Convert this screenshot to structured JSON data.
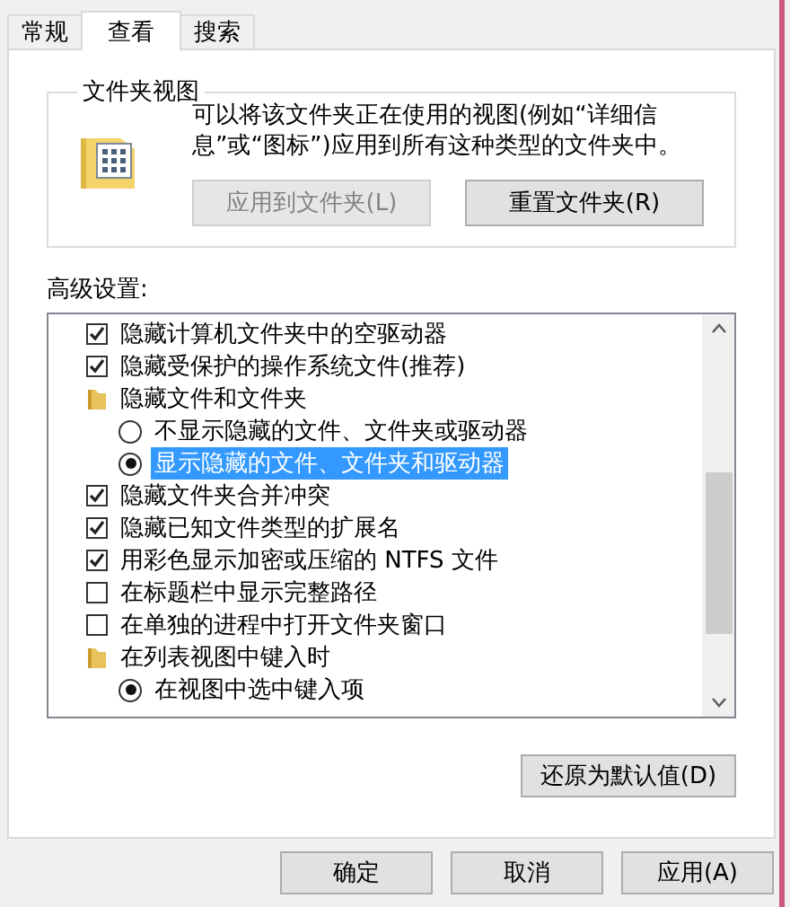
{
  "tabs": [
    {
      "label": "常规",
      "selected": false
    },
    {
      "label": "查看",
      "selected": true
    },
    {
      "label": "搜索",
      "selected": false
    }
  ],
  "folder_views": {
    "title": "文件夹视图",
    "description": "可以将该文件夹正在使用的视图(例如“详细信息”或“图标”)应用到所有这种类型的文件夹中。",
    "buttons": [
      {
        "label": "应用到文件夹(L)",
        "disabled": true
      },
      {
        "label": "重置文件夹(R)",
        "disabled": false
      }
    ]
  },
  "advanced": {
    "label": "高级设置:",
    "items": [
      {
        "kind": "checkbox",
        "label": "隐藏计算机文件夹中的空驱动器",
        "checked": true
      },
      {
        "kind": "checkbox",
        "label": "隐藏受保护的操作系统文件(推荐)",
        "checked": true
      },
      {
        "kind": "folder",
        "label": "隐藏文件和文件夹",
        "children": [
          {
            "kind": "radio",
            "label": "不显示隐藏的文件、文件夹或驱动器",
            "selected": false,
            "highlighted": false
          },
          {
            "kind": "radio",
            "label": "显示隐藏的文件、文件夹和驱动器",
            "selected": true,
            "highlighted": true
          }
        ]
      },
      {
        "kind": "checkbox",
        "label": "隐藏文件夹合并冲突",
        "checked": true
      },
      {
        "kind": "checkbox",
        "label": "隐藏已知文件类型的扩展名",
        "checked": true
      },
      {
        "kind": "checkbox",
        "label": "用彩色显示加密或压缩的 NTFS 文件",
        "checked": true
      },
      {
        "kind": "checkbox",
        "label": "在标题栏中显示完整路径",
        "checked": false
      },
      {
        "kind": "checkbox",
        "label": "在单独的进程中打开文件夹窗口",
        "checked": false
      },
      {
        "kind": "folder",
        "label": "在列表视图中键入时",
        "children": [
          {
            "kind": "radio",
            "label": "在视图中选中键入项",
            "selected": true,
            "highlighted": false
          }
        ]
      }
    ]
  },
  "restore_button": "还原为默认值(D)",
  "dialog_buttons": [
    "确定",
    "取消",
    "应用(A)"
  ]
}
